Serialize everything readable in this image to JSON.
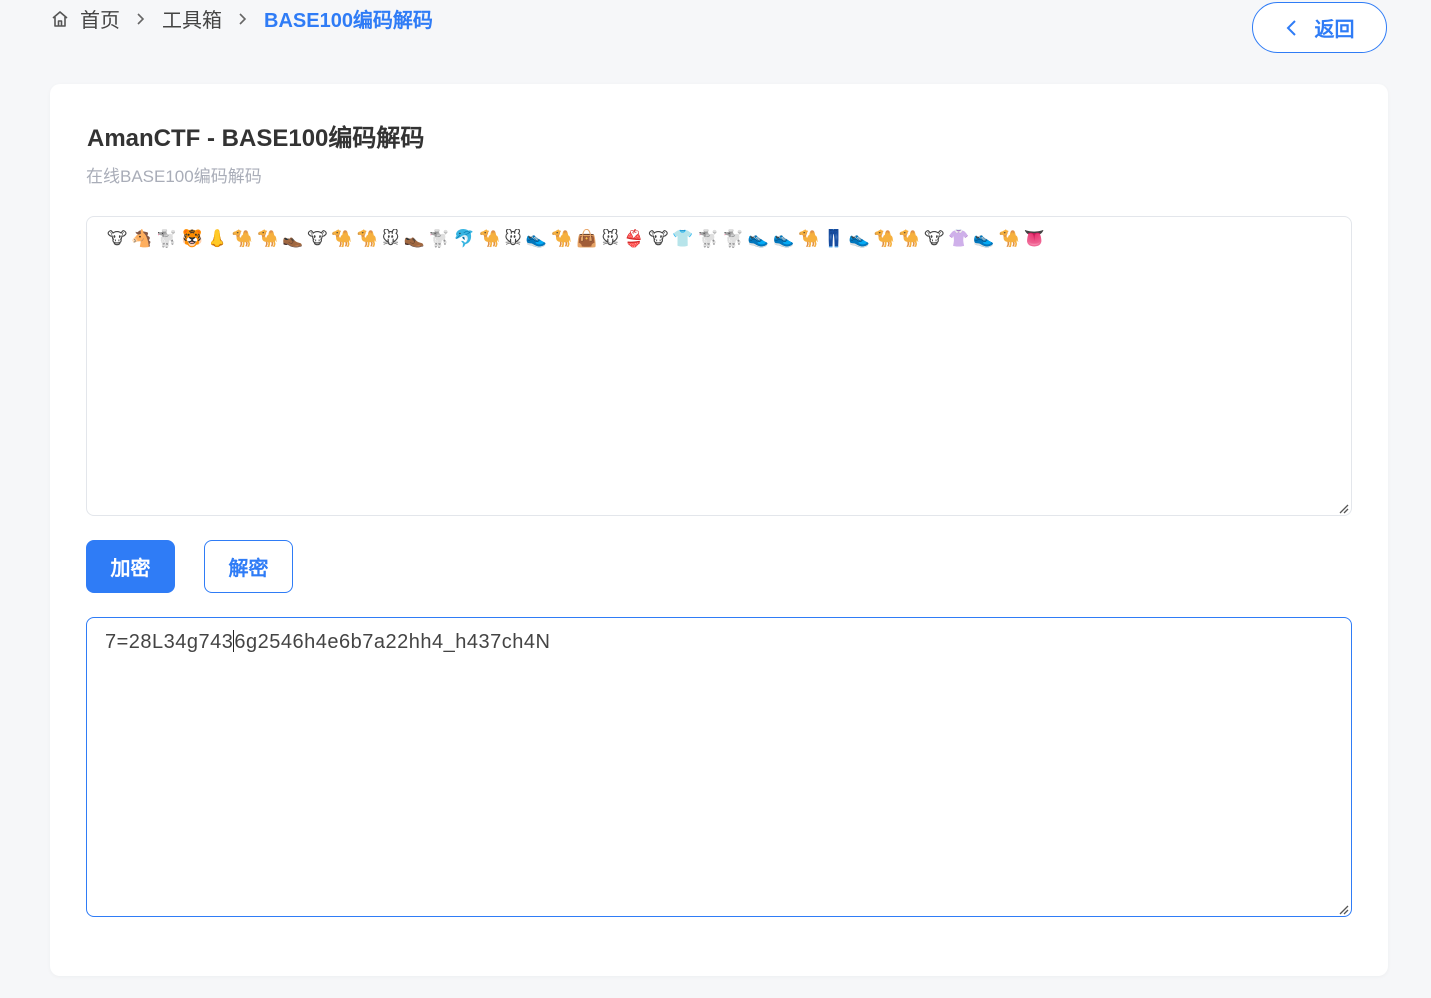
{
  "breadcrumb": {
    "home": "首页",
    "toolbox": "工具箱",
    "current": "BASE100编码解码"
  },
  "header": {
    "back_label": "返回"
  },
  "card": {
    "title": "AmanCTF - BASE100编码解码",
    "subtitle": "在线BASE100编码解码"
  },
  "input": {
    "value": "🐮🐴🐩🐯👃🐪🐪👞🐮🐪🐪🐭👞🐩🐬🐪🐭👟🐪👜🐭👙🐮👕🐩🐩👟👟🐪👖👟🐪🐪🐮👚👟🐪👅"
  },
  "actions": {
    "encrypt_label": "加密",
    "decrypt_label": "解密"
  },
  "output": {
    "value_before_caret": "7=28L34g743",
    "value_after_caret": "6g2546h4e6b7a22hh4_h437ch4N"
  },
  "icons": {
    "home": "home-icon",
    "separator": "chevron-right-icon",
    "back": "chevron-left-icon",
    "resize": "resize-handle-icon"
  },
  "colors": {
    "accent": "#2f7cf6",
    "page_bg": "#f6f7f9",
    "muted_text": "#a9adb8"
  }
}
